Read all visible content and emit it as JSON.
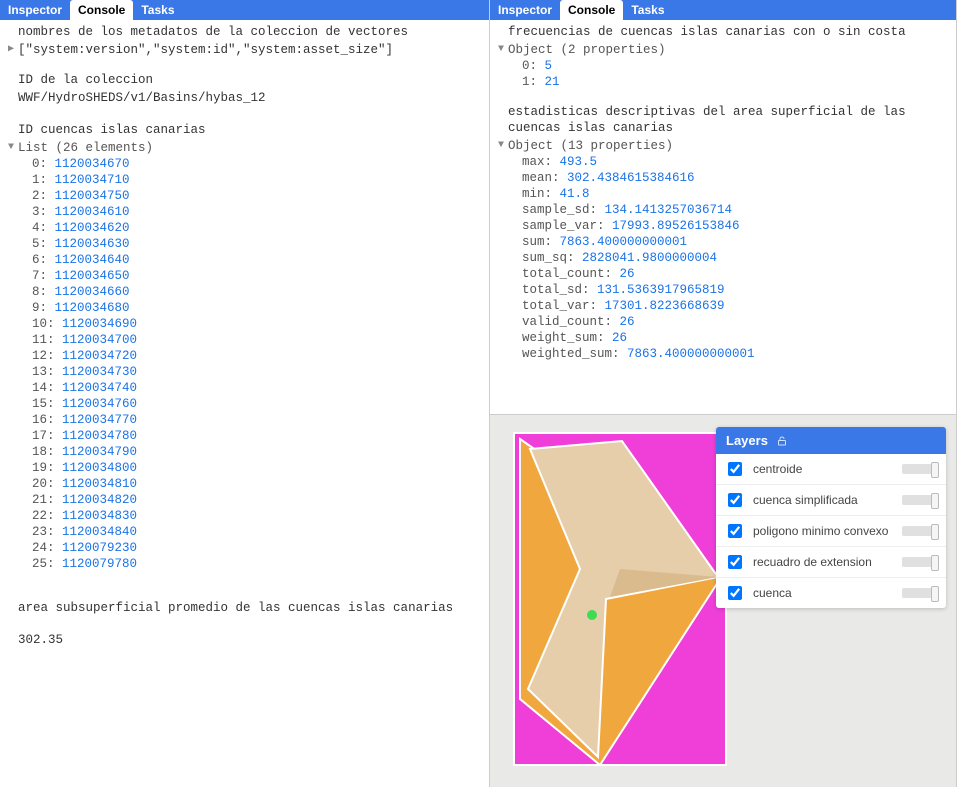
{
  "tabs": {
    "inspector": "Inspector",
    "console": "Console",
    "tasks": "Tasks"
  },
  "left": {
    "msg_metadata": "nombres de los metadatos de la coleccion de vectores",
    "metadata_json": "[\"system:version\",\"system:id\",\"system:asset_size\"]",
    "msg_collection_id": "ID de la coleccion",
    "collection_id": "WWF/HydroSHEDS/v1/Basins/hybas_12",
    "msg_basin_ids": "ID cuencas islas canarias",
    "list_label": "List (26 elements)",
    "basin_ids": [
      1120034670,
      1120034710,
      1120034750,
      1120034610,
      1120034620,
      1120034630,
      1120034640,
      1120034650,
      1120034660,
      1120034680,
      1120034690,
      1120034700,
      1120034720,
      1120034730,
      1120034740,
      1120034760,
      1120034770,
      1120034780,
      1120034790,
      1120034800,
      1120034810,
      1120034820,
      1120034830,
      1120034840,
      1120079230,
      1120079780
    ],
    "msg_avg_area": "area subsuperficial promedio de las cuencas islas canarias",
    "avg_area": "302.35"
  },
  "right": {
    "msg_freq": "frecuencias de cuencas islas canarias con o sin costa",
    "freq_label": "Object (2 properties)",
    "freq": [
      {
        "k": "0",
        "v": "5"
      },
      {
        "k": "1",
        "v": "21"
      }
    ],
    "msg_stats": "estadisticas descriptivas del area superficial de las cuencas islas canarias",
    "stats_label": "Object (13 properties)",
    "stats": [
      {
        "k": "max",
        "v": "493.5"
      },
      {
        "k": "mean",
        "v": "302.4384615384616"
      },
      {
        "k": "min",
        "v": "41.8"
      },
      {
        "k": "sample_sd",
        "v": "134.1413257036714"
      },
      {
        "k": "sample_var",
        "v": "17993.89526153846"
      },
      {
        "k": "sum",
        "v": "7863.400000000001"
      },
      {
        "k": "sum_sq",
        "v": "2828041.9800000004"
      },
      {
        "k": "total_count",
        "v": "26"
      },
      {
        "k": "total_sd",
        "v": "131.5363917965819"
      },
      {
        "k": "total_var",
        "v": "17301.8223668639"
      },
      {
        "k": "valid_count",
        "v": "26"
      },
      {
        "k": "weight_sum",
        "v": "26"
      },
      {
        "k": "weighted_sum",
        "v": "7863.400000000001"
      }
    ]
  },
  "layers": {
    "title": "Layers",
    "items": [
      {
        "name": "centroide",
        "checked": true
      },
      {
        "name": "cuenca simplificada",
        "checked": true
      },
      {
        "name": "poligono minimo convexo",
        "checked": true
      },
      {
        "name": "recuadro de extension",
        "checked": true
      },
      {
        "name": "cuenca",
        "checked": true
      }
    ]
  }
}
